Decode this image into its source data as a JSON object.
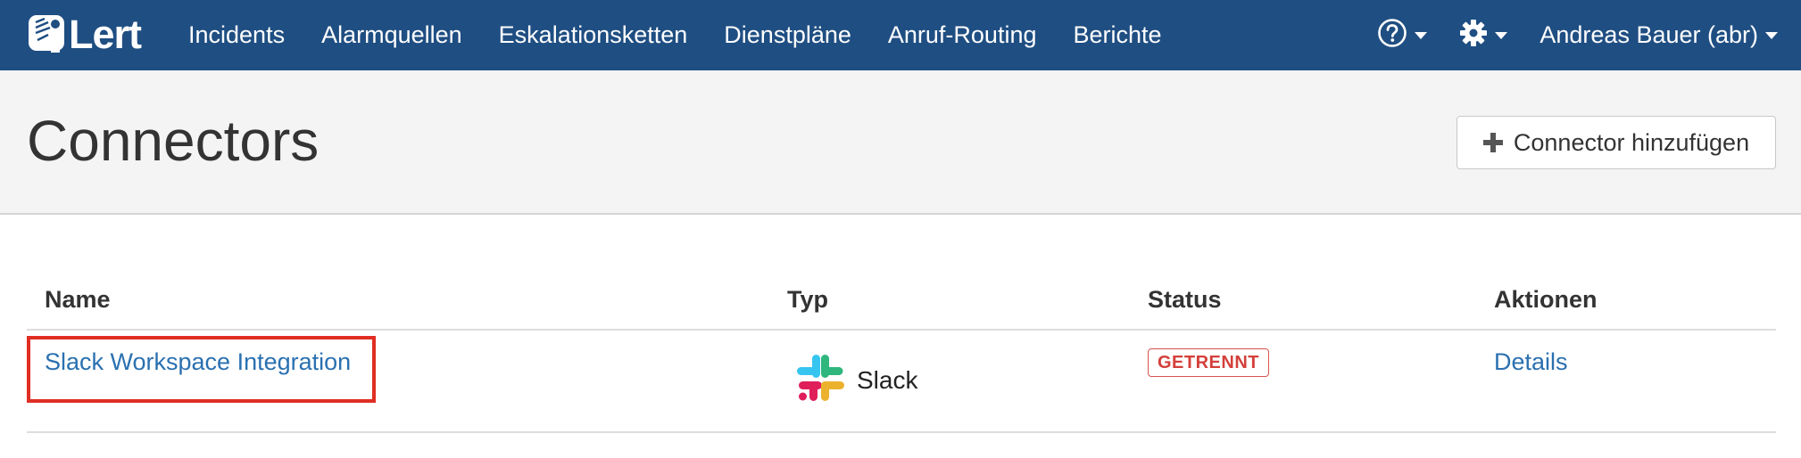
{
  "app": {
    "brand": "iLert",
    "brand_text": "Lert",
    "accent_color": "#1f4e82",
    "link_color": "#2a70b0",
    "highlight_color": "#e02e23"
  },
  "nav": {
    "items": [
      {
        "label": "Incidents"
      },
      {
        "label": "Alarmquellen"
      },
      {
        "label": "Eskalationsketten"
      },
      {
        "label": "Dienstpläne"
      },
      {
        "label": "Anruf-Routing"
      },
      {
        "label": "Berichte"
      }
    ],
    "help_icon": "question-circle-icon",
    "settings_icon": "gear-icon",
    "user_label": "Andreas Bauer (abr)"
  },
  "page": {
    "title": "Connectors",
    "add_button_label": "Connector hinzufügen",
    "add_button_icon": "plus-icon"
  },
  "table": {
    "columns": [
      "Name",
      "Typ",
      "Status",
      "Aktionen"
    ],
    "rows": [
      {
        "name": "Slack Workspace Integration",
        "type": "Slack",
        "type_icon": "slack-icon",
        "status": "GETRENNT",
        "action": "Details"
      }
    ]
  }
}
